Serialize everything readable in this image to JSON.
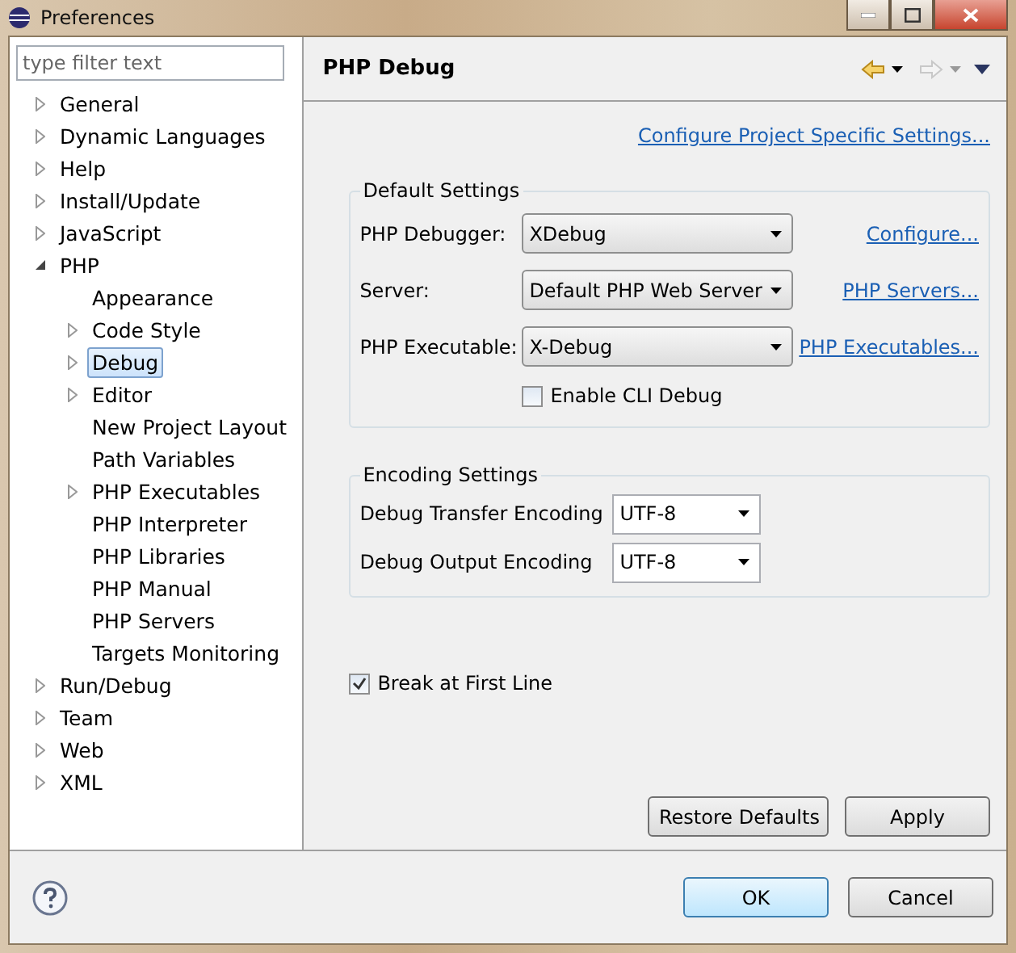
{
  "window": {
    "title": "Preferences"
  },
  "filter": {
    "placeholder": "type filter text"
  },
  "tree": [
    {
      "label": "General",
      "expanded": false,
      "selected": false
    },
    {
      "label": "Dynamic Languages",
      "expanded": false,
      "selected": false
    },
    {
      "label": "Help",
      "expanded": false,
      "selected": false
    },
    {
      "label": "Install/Update",
      "expanded": false,
      "selected": false
    },
    {
      "label": "JavaScript",
      "expanded": false,
      "selected": false
    },
    {
      "label": "PHP",
      "expanded": true,
      "selected": false,
      "children": [
        {
          "label": "Appearance",
          "selected": false
        },
        {
          "label": "Code Style",
          "expanded": false,
          "selected": false
        },
        {
          "label": "Debug",
          "expanded": false,
          "selected": true
        },
        {
          "label": "Editor",
          "expanded": false,
          "selected": false
        },
        {
          "label": "New Project Layout",
          "selected": false
        },
        {
          "label": "Path Variables",
          "selected": false
        },
        {
          "label": "PHP Executables",
          "expanded": false,
          "selected": false
        },
        {
          "label": "PHP Interpreter",
          "selected": false
        },
        {
          "label": "PHP Libraries",
          "selected": false
        },
        {
          "label": "PHP Manual",
          "selected": false
        },
        {
          "label": "PHP Servers",
          "selected": false
        },
        {
          "label": "Targets Monitoring",
          "selected": false
        }
      ]
    },
    {
      "label": "Run/Debug",
      "expanded": false,
      "selected": false
    },
    {
      "label": "Team",
      "expanded": false,
      "selected": false
    },
    {
      "label": "Web",
      "expanded": false,
      "selected": false
    },
    {
      "label": "XML",
      "expanded": false,
      "selected": false
    }
  ],
  "page": {
    "title": "PHP Debug",
    "project_link": "Configure Project Specific Settings...",
    "default_settings": {
      "title": "Default Settings",
      "rows": [
        {
          "label": "PHP Debugger:",
          "value": "XDebug",
          "link": "Configure..."
        },
        {
          "label": "Server:",
          "value": "Default PHP Web Server",
          "link": "PHP Servers..."
        },
        {
          "label": "PHP Executable:",
          "value": "X-Debug",
          "link": "PHP Executables..."
        }
      ],
      "cli": {
        "label": "Enable CLI Debug",
        "checked": false
      }
    },
    "encoding_settings": {
      "title": "Encoding Settings",
      "rows": [
        {
          "label": "Debug Transfer Encoding",
          "value": "UTF-8"
        },
        {
          "label": "Debug Output Encoding",
          "value": "UTF-8"
        }
      ]
    },
    "break": {
      "label": "Break at First Line",
      "checked": true
    },
    "buttons": [
      "Restore Defaults",
      "Apply"
    ]
  },
  "dialog_buttons": [
    {
      "label": "OK",
      "default": true
    },
    {
      "label": "Cancel",
      "default": false
    }
  ]
}
